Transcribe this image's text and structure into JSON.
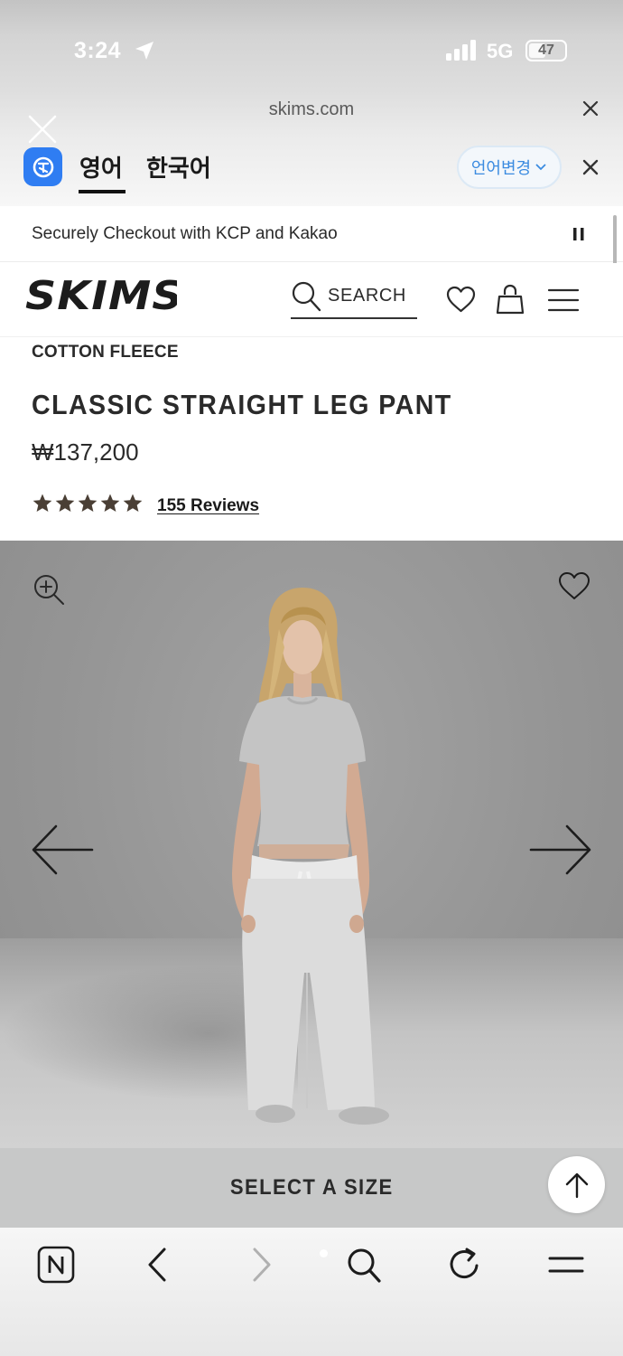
{
  "status_bar": {
    "time": "3:24",
    "network": "5G",
    "battery": "47",
    "battery_level": 0.47
  },
  "browser": {
    "url": "skims.com",
    "translate": {
      "tab_english": "영어",
      "tab_korean": "한국어",
      "change_language": "언어변경"
    }
  },
  "promo": {
    "text": "Securely Checkout with KCP and Kakao"
  },
  "header": {
    "logo": "SKIMS",
    "search_label": "SEARCH"
  },
  "product": {
    "category": "COTTON FLEECE",
    "title": "CLASSIC STRAIGHT LEG PANT",
    "price": "₩137,200",
    "rating": 5,
    "reviews_label": "155 Reviews"
  },
  "cta": {
    "select_size": "SELECT A SIZE"
  },
  "icons": [
    "location-arrow-icon",
    "signal-icon",
    "battery-icon",
    "close-icon",
    "translate-logo-icon",
    "chevron-down-icon",
    "pause-icon",
    "search-icon",
    "heart-icon",
    "bag-icon",
    "menu-icon",
    "zoom-in-icon",
    "arrow-left-icon",
    "arrow-right-icon",
    "arrow-up-icon",
    "n-icon",
    "chevron-left-icon",
    "chevron-right-icon",
    "reload-icon"
  ],
  "colors": {
    "translate_blue": "#2f7df2",
    "link_blue": "#3b8be0",
    "star_brown": "#4a3f35",
    "size_bar": "#c7c8c8"
  }
}
